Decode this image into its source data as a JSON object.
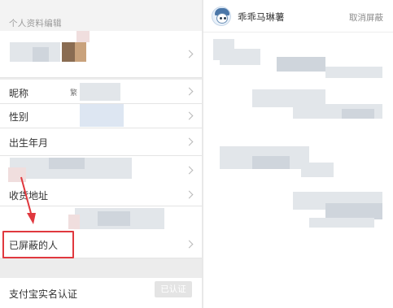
{
  "left_panel": {
    "section_title": "个人资料编辑",
    "rows": {
      "nickname": {
        "label": "昵称",
        "value": "繁"
      },
      "gender": {
        "label": "性别"
      },
      "birthday": {
        "label": "出生年月"
      },
      "address": {
        "label": "收货地址"
      },
      "blocked": {
        "label": "已屏蔽的人"
      },
      "alipay": {
        "label": "支付宝实名认证",
        "button": "已认证"
      }
    },
    "highlight_color": "#e0383e"
  },
  "right_panel": {
    "blocked_user": {
      "name": "乖乖马琳薯",
      "action": "取消屏蔽"
    }
  }
}
